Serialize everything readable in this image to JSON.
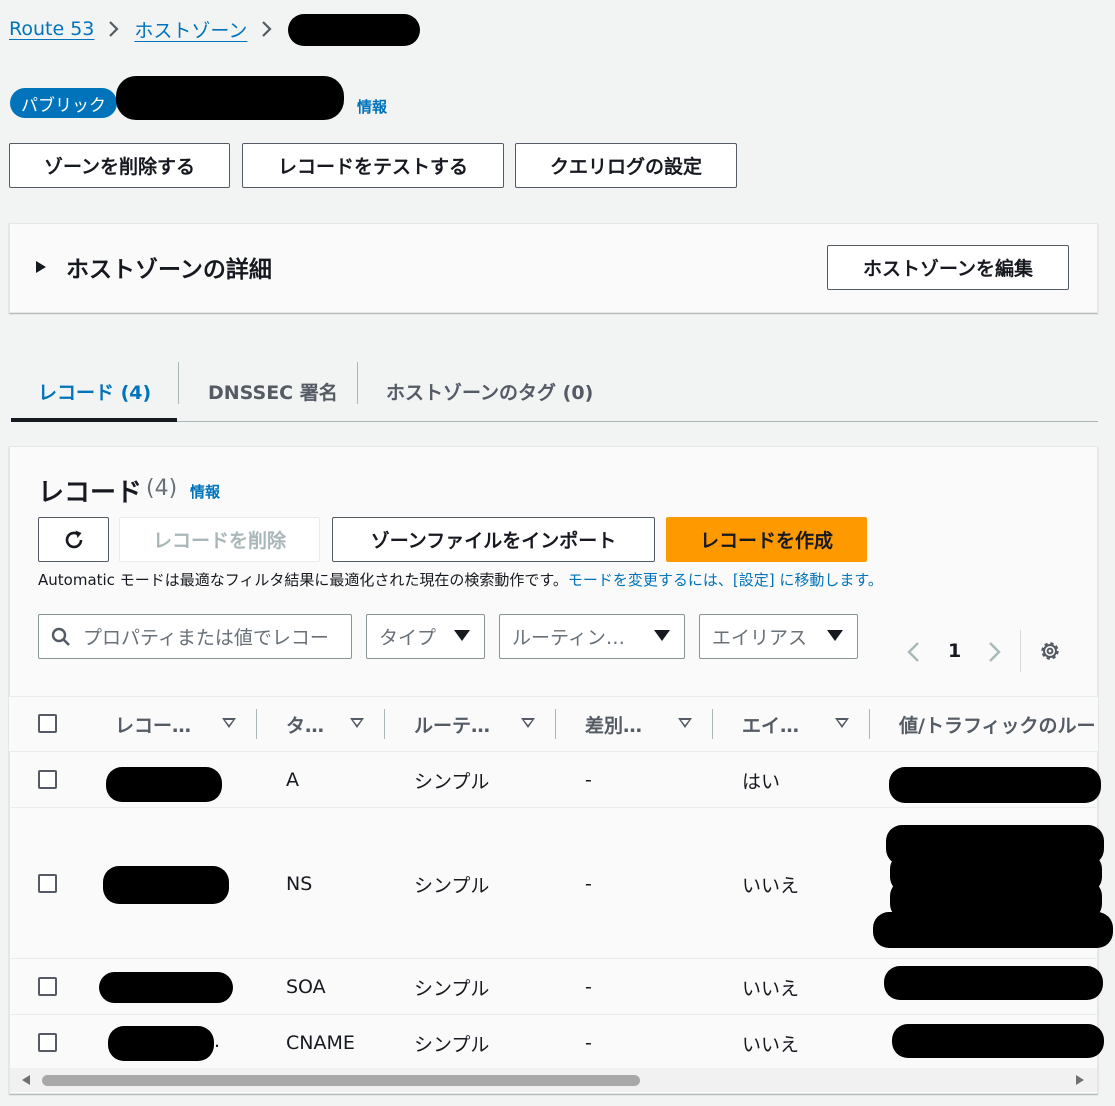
{
  "breadcrumb": {
    "items": [
      "Route 53",
      "ホストゾーン"
    ]
  },
  "zone": {
    "badge": "パブリック",
    "info_link": "情報"
  },
  "actions": {
    "delete_zone": "ゾーンを削除する",
    "test_record": "レコードをテストする",
    "query_log": "クエリログの設定"
  },
  "details": {
    "title": "ホストゾーンの詳細",
    "edit_button": "ホストゾーンを編集"
  },
  "tabs": [
    {
      "label": "レコード (4)"
    },
    {
      "label": "DNSSEC 署名"
    },
    {
      "label": "ホストゾーンのタグ (0)"
    }
  ],
  "records": {
    "title": "レコード",
    "count": "(4)",
    "info_link": "情報",
    "buttons": {
      "delete": "レコードを削除",
      "import": "ゾーンファイルをインポート",
      "create": "レコードを作成"
    },
    "notice_text": "Automatic モードは最適なフィルタ結果に最適化された現在の検索動作です。",
    "notice_link": "モードを変更するには、[設定] に移動します。",
    "search_placeholder": "プロパティまたは値でレコー",
    "filters": {
      "type": "タイプ",
      "routing": "ルーティン…",
      "alias": "エイリアス"
    },
    "page": "1",
    "columns": [
      "レコー…",
      "タ…",
      "ルーテ…",
      "差別…",
      "エイ…",
      "値/トラフィックのルー"
    ],
    "rows": [
      {
        "type": "A",
        "routing": "シンプル",
        "diff": "-",
        "alias": "はい"
      },
      {
        "type": "NS",
        "routing": "シンプル",
        "diff": "-",
        "alias": "いいえ"
      },
      {
        "type": "SOA",
        "routing": "シンプル",
        "diff": "-",
        "alias": "いいえ"
      },
      {
        "type": "CNAME",
        "routing": "シンプル",
        "diff": "-",
        "alias": "いいえ"
      }
    ]
  }
}
